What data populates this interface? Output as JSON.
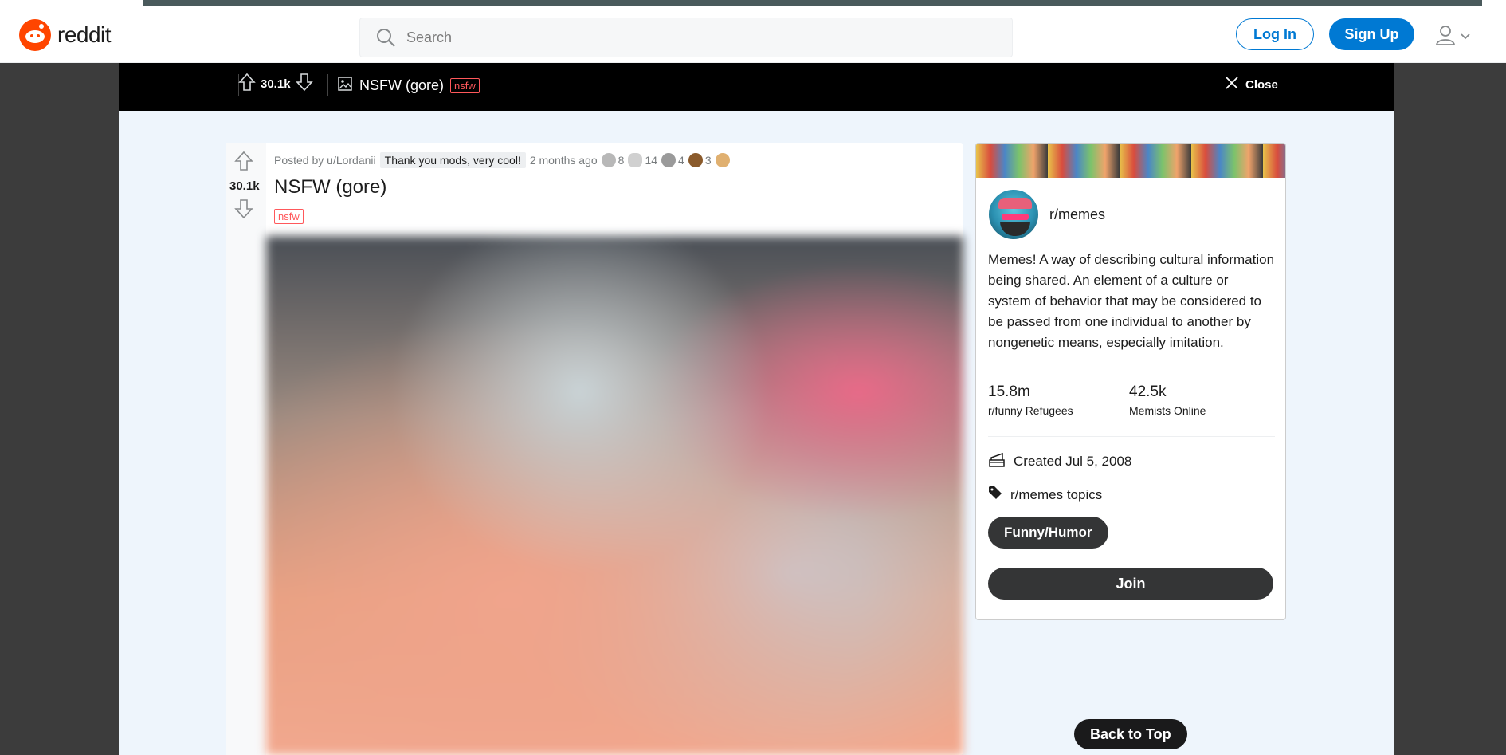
{
  "header": {
    "logo_text": "reddit",
    "search_placeholder": "Search",
    "login_label": "Log In",
    "signup_label": "Sign Up",
    "user_icon": "user-icon"
  },
  "postbar": {
    "vote_count": "30.1k",
    "title": "NSFW (gore)",
    "nsfw_tag": "nsfw",
    "close_label": "Close"
  },
  "post": {
    "vote_count": "30.1k",
    "posted_by": "Posted by u/Lordanii",
    "flair": "Thank you mods, very cool!",
    "time_ago": "2 months ago",
    "awards": [
      {
        "icon": "award-1-icon",
        "count": "8"
      },
      {
        "icon": "award-2-icon",
        "count": "14"
      },
      {
        "icon": "award-3-icon",
        "count": "4"
      },
      {
        "icon": "award-4-icon",
        "count": "3"
      },
      {
        "icon": "award-5-icon",
        "count": ""
      }
    ],
    "title": "NSFW (gore)",
    "nsfw_tag": "nsfw"
  },
  "sidebar": {
    "subreddit": "r/memes",
    "description": "Memes! A way of describing cultural information being shared. An element of a culture or system of behavior that may be considered to be passed from one individual to another by nongenetic means, especially imitation.",
    "members_count": "15.8m",
    "members_label": "r/funny Refugees",
    "online_count": "42.5k",
    "online_label": "Memists Online",
    "created": "Created Jul 5, 2008",
    "topics_label": "r/memes topics",
    "topic_pill": "Funny/Humor",
    "join_label": "Join"
  },
  "back_to_top": "Back to Top",
  "colors": {
    "accent": "#0079d3",
    "brand": "#ff4500",
    "nsfw": "#ff585b",
    "dark_button": "#343536"
  }
}
